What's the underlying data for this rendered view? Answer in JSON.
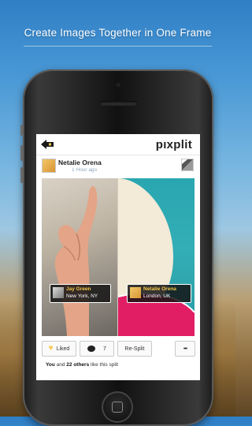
{
  "headline": "Create Images Together in One Frame",
  "app": {
    "logo": "pıxplit",
    "post": {
      "author": "Netalie Orena",
      "time": "1 Hour ago"
    },
    "tags": [
      {
        "name": "Jay Green",
        "location": "New York, NY"
      },
      {
        "name": "Netalie Orena",
        "location": "London, UK"
      }
    ],
    "actions": {
      "like_label": "Liked",
      "comment_count": "7",
      "resplit_label": "Re-Split",
      "more_label": "•••"
    },
    "likes": {
      "you": "You",
      "and": "and",
      "others": "22 others",
      "suffix": "like this split"
    }
  },
  "colors": {
    "accent_gold": "#f5c84a",
    "sky": "#2f7fc6"
  }
}
